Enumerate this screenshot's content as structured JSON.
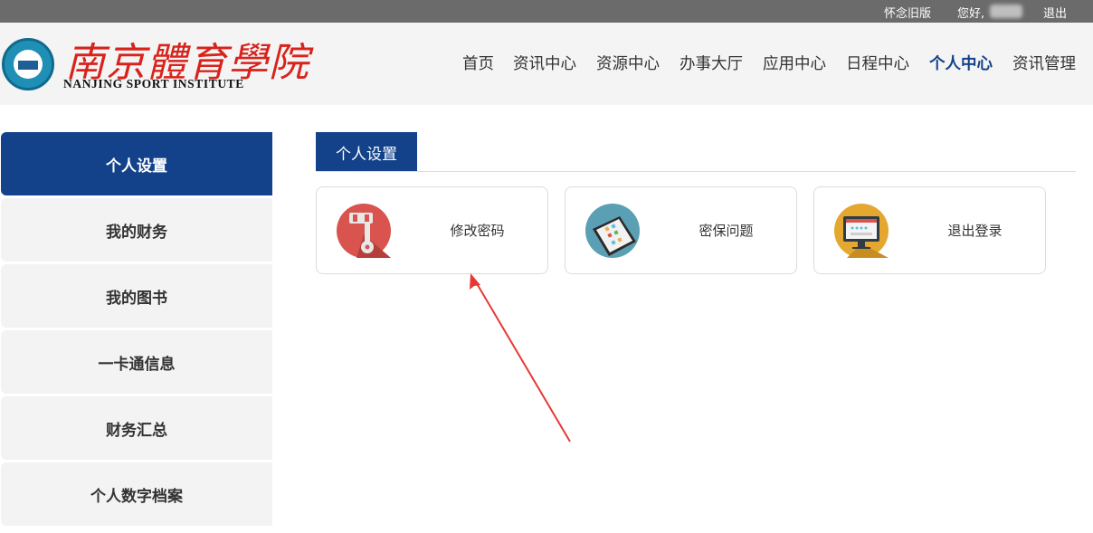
{
  "topbar": {
    "old_version": "怀念旧版",
    "greeting": "您好,",
    "logout": "退出"
  },
  "header": {
    "logo_cn": "南京體育學院",
    "logo_en": "NANJING SPORT INSTITUTE"
  },
  "nav": {
    "items": [
      "首页",
      "资讯中心",
      "资源中心",
      "办事大厅",
      "应用中心",
      "日程中心",
      "个人中心",
      "资讯管理"
    ],
    "active": "个人中心"
  },
  "sidebar": {
    "items": [
      "个人设置",
      "我的财务",
      "我的图书",
      "一卡通信息",
      "财务汇总",
      "个人数字档案"
    ],
    "active": "个人设置"
  },
  "main": {
    "section_title": "个人设置",
    "cards": [
      {
        "label": "修改密码",
        "icon": "key-icon"
      },
      {
        "label": "密保问题",
        "icon": "phone-icon"
      },
      {
        "label": "退出登录",
        "icon": "monitor-icon"
      }
    ]
  },
  "colors": {
    "brand_blue": "#13428a",
    "topbar_gray": "#6b6b6b",
    "logo_red": "#d8231c",
    "annotation_red": "#e53935"
  }
}
